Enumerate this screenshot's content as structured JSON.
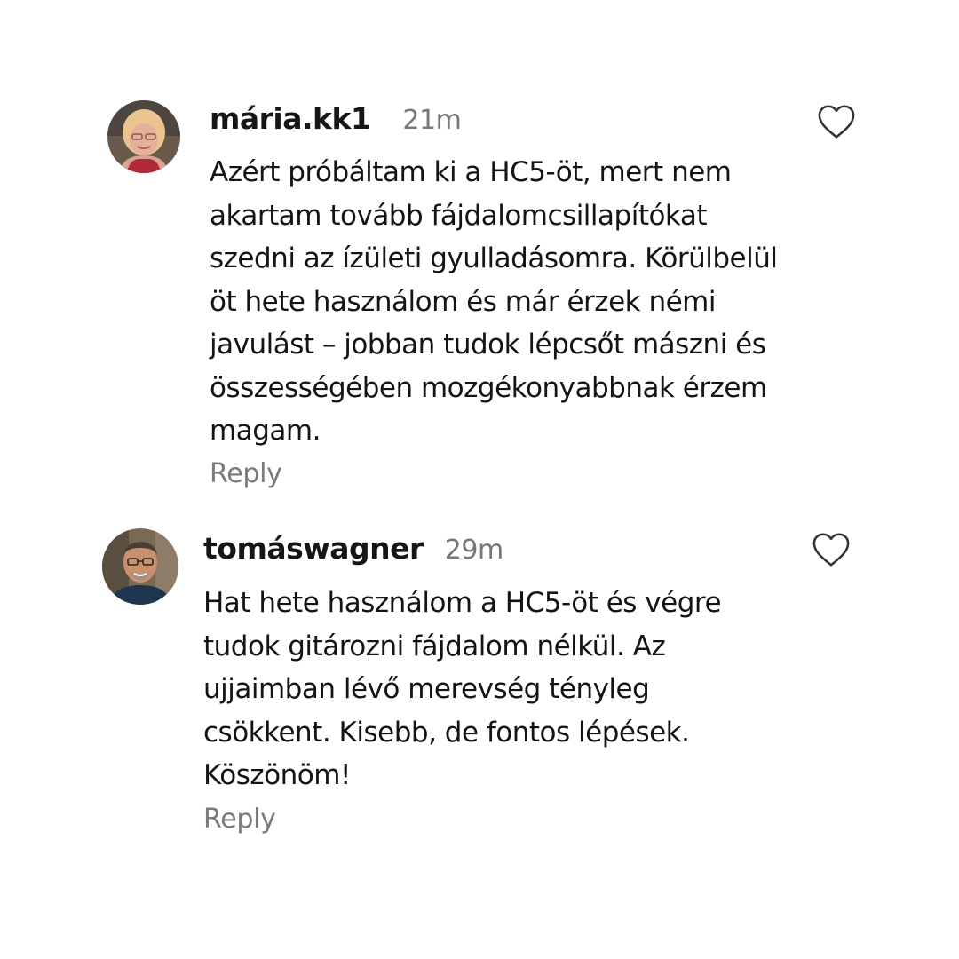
{
  "comments": [
    {
      "username": "mária.kk1",
      "time": "21m",
      "lines": [
        "Azért próbáltam ki a HC5-öt, mert nem",
        "akartam tovább fájdalomcsillapítókat",
        "szedni az ízületi gyulladásomra. Körülbelül",
        "öt hete használom és már érzek némi",
        "javulást – jobban tudok lépcsőt mászni és",
        "összességében mozgékonyabbnak érzem",
        "magam."
      ],
      "reply_label": "Reply",
      "avatar_icon": "user-avatar-photo",
      "like_icon": "heart-outline-icon"
    },
    {
      "username": "tomáswagner",
      "time": "29m",
      "lines": [
        "Hat hete használom a HC5-öt és végre",
        "tudok gitározni fájdalom nélkül. Az",
        "ujjaimban lévő merevség tényleg",
        "csökkent. Kisebb, de fontos lépések.",
        "Köszönöm!"
      ],
      "reply_label": "Reply",
      "avatar_icon": "user-avatar-photo",
      "like_icon": "heart-outline-icon"
    }
  ],
  "colors": {
    "background": "#ffffff",
    "text": "#141414",
    "muted": "#777777"
  }
}
